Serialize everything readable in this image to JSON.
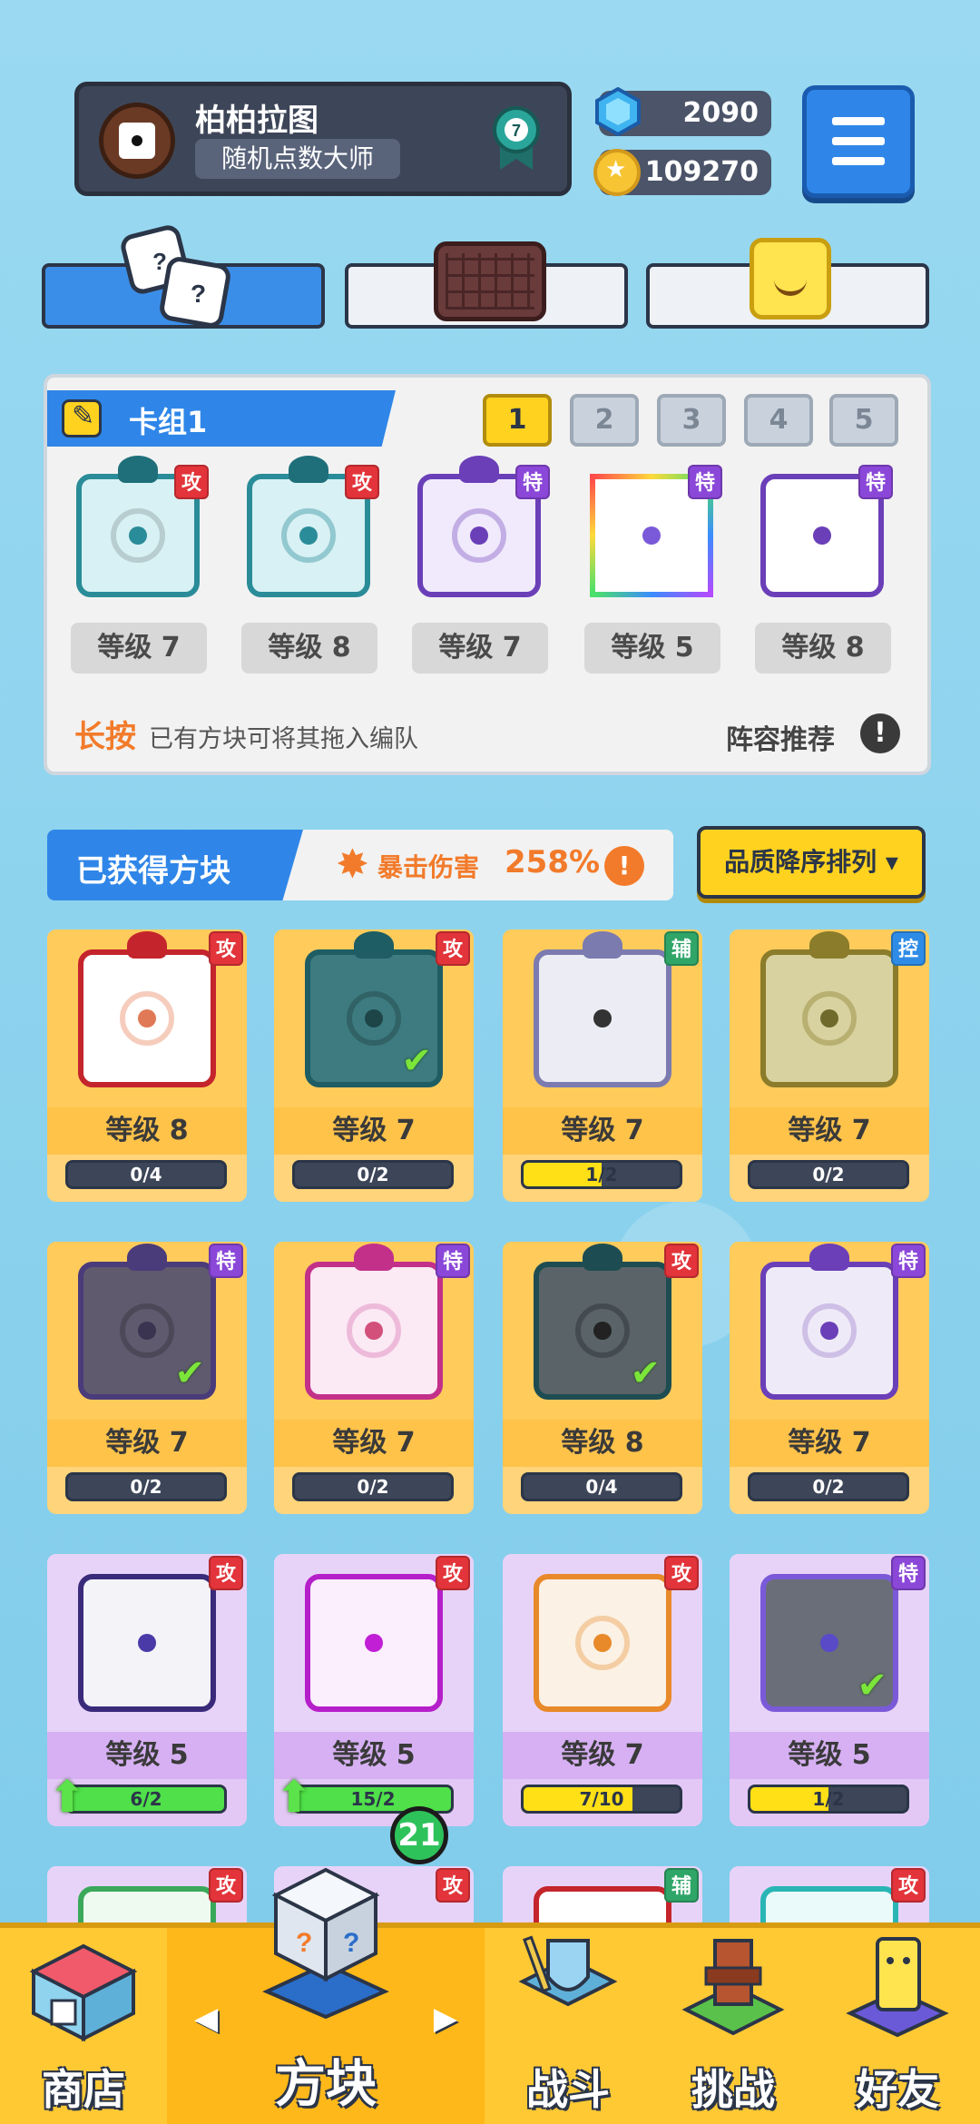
{
  "player": {
    "name": "柏柏拉图",
    "title": "随机点数大师",
    "rank": "7"
  },
  "currency": {
    "gems": "2090",
    "coins": "109270"
  },
  "deck": {
    "title": "卡组1",
    "numbers": [
      "1",
      "2",
      "3",
      "4",
      "5"
    ],
    "active_number": 1,
    "slots": [
      {
        "tag": "攻",
        "level": "等级 7"
      },
      {
        "tag": "攻",
        "level": "等级 8"
      },
      {
        "tag": "特",
        "level": "等级 7"
      },
      {
        "tag": "特",
        "level": "等级 5"
      },
      {
        "tag": "特",
        "level": "等级 8"
      }
    ],
    "hint_emphasis": "长按",
    "hint": "已有方块可将其拖入编队",
    "lineup_recommend": "阵容推荐",
    "info_glyph": "!"
  },
  "owned": {
    "label": "已获得方块",
    "crit_label": "暴击伤害",
    "crit_value": "258%",
    "info_glyph": "!",
    "sort_label": "品质降序排列 ▾"
  },
  "cards": [
    {
      "tag": "攻",
      "level": "等级 8",
      "progress": "0/4",
      "fraction": 0
    },
    {
      "tag": "攻",
      "level": "等级 7",
      "progress": "0/2",
      "fraction": 0
    },
    {
      "tag": "辅",
      "level": "等级 7",
      "progress": "1/2",
      "fraction": 0.5
    },
    {
      "tag": "控",
      "level": "等级 7",
      "progress": "0/2",
      "fraction": 0
    },
    {
      "tag": "特",
      "level": "等级 7",
      "progress": "0/2",
      "fraction": 0
    },
    {
      "tag": "特",
      "level": "等级 7",
      "progress": "0/2",
      "fraction": 0
    },
    {
      "tag": "攻",
      "level": "等级 8",
      "progress": "0/4",
      "fraction": 0
    },
    {
      "tag": "特",
      "level": "等级 7",
      "progress": "0/2",
      "fraction": 0
    },
    {
      "tag": "攻",
      "level": "等级 5",
      "progress": "6/2",
      "fraction": 1
    },
    {
      "tag": "攻",
      "level": "等级 5",
      "progress": "15/2",
      "fraction": 1
    },
    {
      "tag": "攻",
      "level": "等级 7",
      "progress": "7/10",
      "fraction": 0.7
    },
    {
      "tag": "特",
      "level": "等级 5",
      "progress": "1/2",
      "fraction": 0.5
    },
    {
      "tag": "攻"
    },
    {
      "tag": "攻"
    },
    {
      "tag": "辅"
    },
    {
      "tag": "攻"
    }
  ],
  "nav": {
    "shop": "商店",
    "dice": "方块",
    "battle": "战斗",
    "challenge": "挑战",
    "friends": "好友",
    "badge": "21",
    "arrow_left": "◀",
    "arrow_right": "▶"
  },
  "colors": {
    "accent_blue": "#2f86e8",
    "gold": "#ffc934",
    "attack": "#e2343a",
    "special": "#8a47d8",
    "support": "#2fa567",
    "control": "#2f8ce6"
  }
}
